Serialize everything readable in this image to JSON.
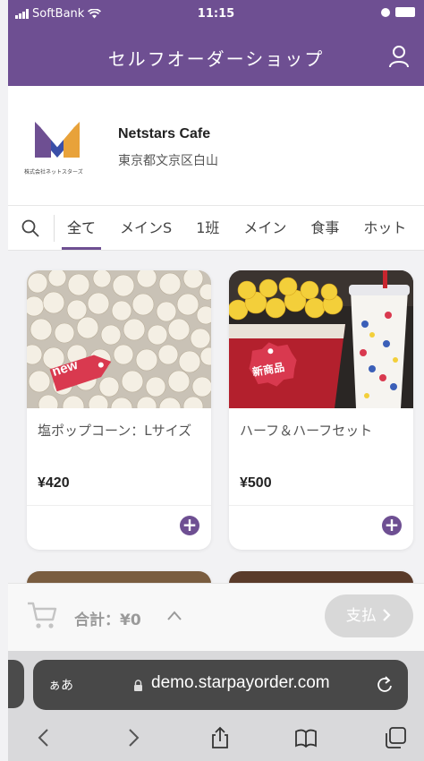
{
  "status_bar": {
    "carrier": "SoftBank",
    "time": "11:15"
  },
  "header": {
    "title": "セルフオーダーショップ"
  },
  "store": {
    "logo_caption": "株式会社ネットスターズ",
    "name": "Netstars Cafe",
    "address": "東京都文京区白山"
  },
  "category_tabs": [
    "全て",
    "メインS",
    "1班",
    "メイン",
    "食事",
    "ホット"
  ],
  "active_tab": "全て",
  "products": [
    {
      "badge": "new",
      "name": "塩ポップコーン：Lサイズ",
      "price": "¥420"
    },
    {
      "badge": "新商品",
      "name": "ハーフ＆ハーフセット",
      "price": "¥500"
    }
  ],
  "cart": {
    "total_label": "合計：¥0",
    "pay_label": "支払"
  },
  "browser": {
    "aa": "ぁあ",
    "url": "demo.starpayorder.com"
  },
  "colors": {
    "brand_purple": "#6e4f92",
    "badge_red": "#d9394f",
    "disabled_gray": "#d8d8d8"
  }
}
